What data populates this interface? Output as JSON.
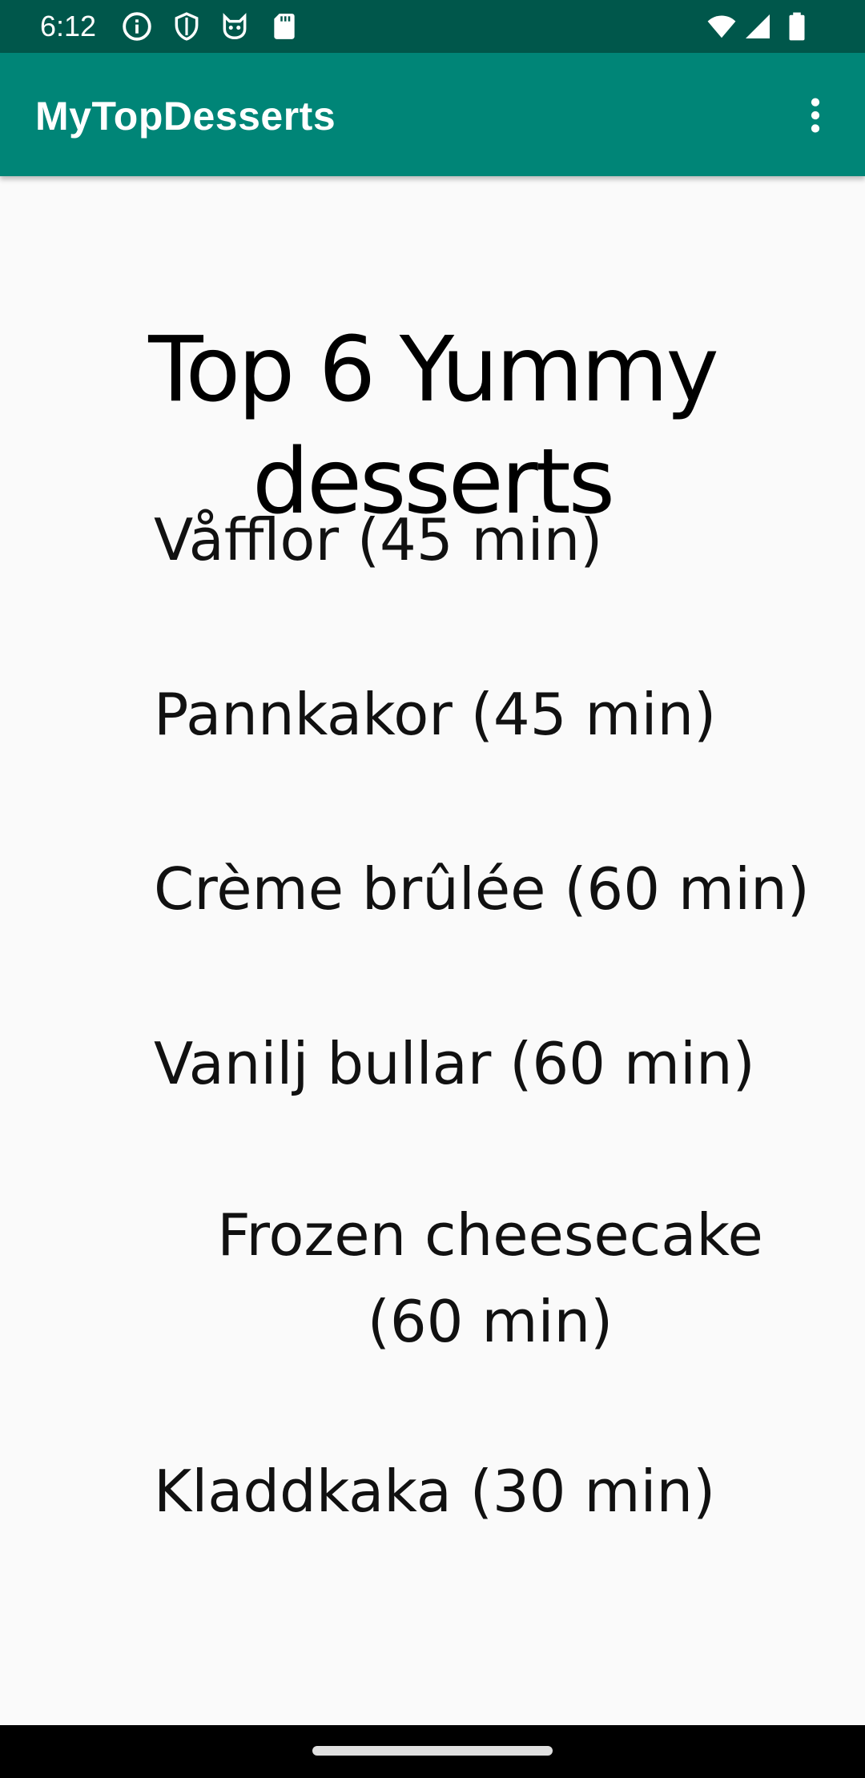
{
  "status_bar": {
    "time": "6:12",
    "icons_left": [
      "info-icon",
      "shield-icon",
      "cat-icon",
      "sd-card-icon"
    ],
    "icons_right": [
      "wifi-icon",
      "signal-icon",
      "battery-icon"
    ],
    "color": "#00574b"
  },
  "app_bar": {
    "title": "MyTopDesserts",
    "menu_icon": "more-vert-icon",
    "color": "#008577"
  },
  "content": {
    "heading": "Top 6 Yummy desserts",
    "desserts": [
      "Våfflor (45 min)",
      "Pannkakor (45 min)",
      "Crème brûlée (60 min)",
      "Vanilj bullar (60 min)",
      "Frozen cheesecake (60 min)",
      "Kladdkaka (30 min)"
    ]
  }
}
